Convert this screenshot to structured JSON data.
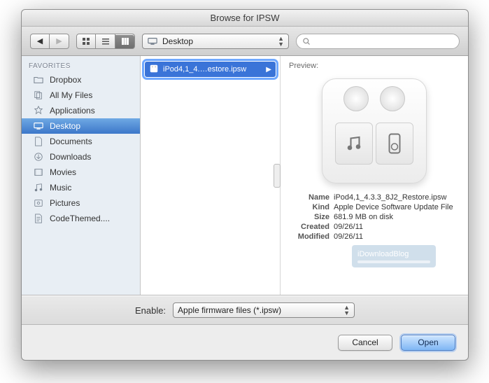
{
  "window": {
    "title": "Browse for IPSW"
  },
  "toolbar": {
    "path_location": "Desktop",
    "search_placeholder": ""
  },
  "sidebar": {
    "header": "FAVORITES",
    "items": [
      {
        "label": "Dropbox",
        "icon": "folder-icon"
      },
      {
        "label": "All My Files",
        "icon": "all-files-icon"
      },
      {
        "label": "Applications",
        "icon": "applications-icon"
      },
      {
        "label": "Desktop",
        "icon": "desktop-icon",
        "selected": true
      },
      {
        "label": "Documents",
        "icon": "documents-icon"
      },
      {
        "label": "Downloads",
        "icon": "downloads-icon"
      },
      {
        "label": "Movies",
        "icon": "movies-icon"
      },
      {
        "label": "Music",
        "icon": "music-icon"
      },
      {
        "label": "Pictures",
        "icon": "pictures-icon"
      },
      {
        "label": "CodeThemed....",
        "icon": "file-icon"
      }
    ]
  },
  "column": {
    "selected_file": "iPod4,1_4.…estore.ipsw"
  },
  "preview": {
    "header": "Preview:",
    "meta": {
      "name_key": "Name",
      "name_val": "iPod4,1_4.3.3_8J2_Restore.ipsw",
      "kind_key": "Kind",
      "kind_val": "Apple Device Software Update File",
      "size_key": "Size",
      "size_val": "681.9 MB on disk",
      "created_key": "Created",
      "created_val": "09/26/11",
      "modified_key": "Modified",
      "modified_val": "09/26/11"
    }
  },
  "filter": {
    "label": "Enable:",
    "value": "Apple firmware files (*.ipsw)"
  },
  "buttons": {
    "cancel": "Cancel",
    "open": "Open"
  },
  "watermark": "iDownloadBlog"
}
